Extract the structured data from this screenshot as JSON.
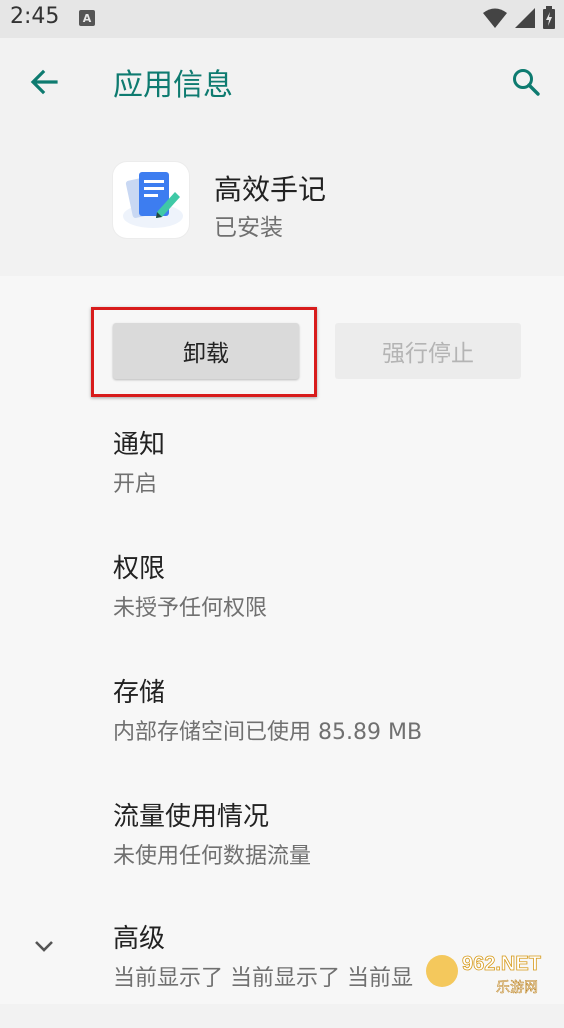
{
  "status_bar": {
    "time": "2:45",
    "notification_icon_letter": "A"
  },
  "app_bar": {
    "title": "应用信息"
  },
  "app": {
    "name": "高效手记",
    "status": "已安装"
  },
  "buttons": {
    "uninstall": "卸载",
    "force_stop": "强行停止"
  },
  "preferences": [
    {
      "title": "通知",
      "summary": "开启"
    },
    {
      "title": "权限",
      "summary": "未授予任何权限"
    },
    {
      "title": "存储",
      "summary": "内部存储空间已使用 85.89 MB"
    },
    {
      "title": "流量使用情况",
      "summary": "未使用任何数据流量"
    },
    {
      "title": "高级",
      "summary": "当前显示了 当前显示了 当前显"
    }
  ],
  "watermark": {
    "text": "962.NET",
    "subtext": "乐游网"
  },
  "colors": {
    "accent": "#0e7b70",
    "highlight": "#d81c1c",
    "background": "#f7f7f7"
  },
  "icons": [
    "back-arrow-icon",
    "search-icon",
    "wifi-icon",
    "signal-icon",
    "battery-icon",
    "chevron-down-icon",
    "notes-app-icon"
  ]
}
